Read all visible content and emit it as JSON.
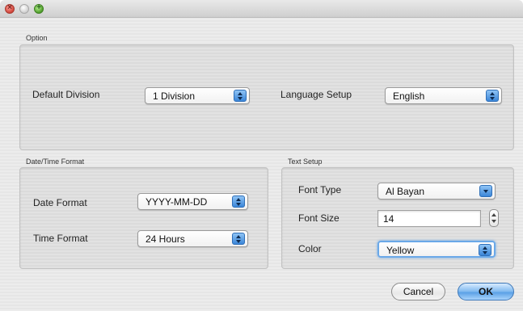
{
  "window": {
    "title": ""
  },
  "option": {
    "group_label": "Option",
    "default_division": {
      "label": "Default Division",
      "value": "1 Division"
    },
    "language_setup": {
      "label": "Language Setup",
      "value": "English"
    }
  },
  "datetime": {
    "group_label": "Date/Time Format",
    "date_format": {
      "label": "Date Format",
      "value": "YYYY-MM-DD"
    },
    "time_format": {
      "label": "Time Format",
      "value": "24 Hours"
    }
  },
  "text_setup": {
    "group_label": "Text Setup",
    "font_type": {
      "label": "Font Type",
      "value": "Al Bayan"
    },
    "font_size": {
      "label": "Font Size",
      "value": "14"
    },
    "color": {
      "label": "Color",
      "value": "Yellow"
    }
  },
  "buttons": {
    "cancel": "Cancel",
    "ok": "OK"
  },
  "icons": {
    "close": "close-icon",
    "minimize": "minimize-icon",
    "zoom": "zoom-icon"
  },
  "colors": {
    "accent": "#5aa0e6",
    "close": "#d0453a",
    "zoom": "#4f9d2b"
  }
}
